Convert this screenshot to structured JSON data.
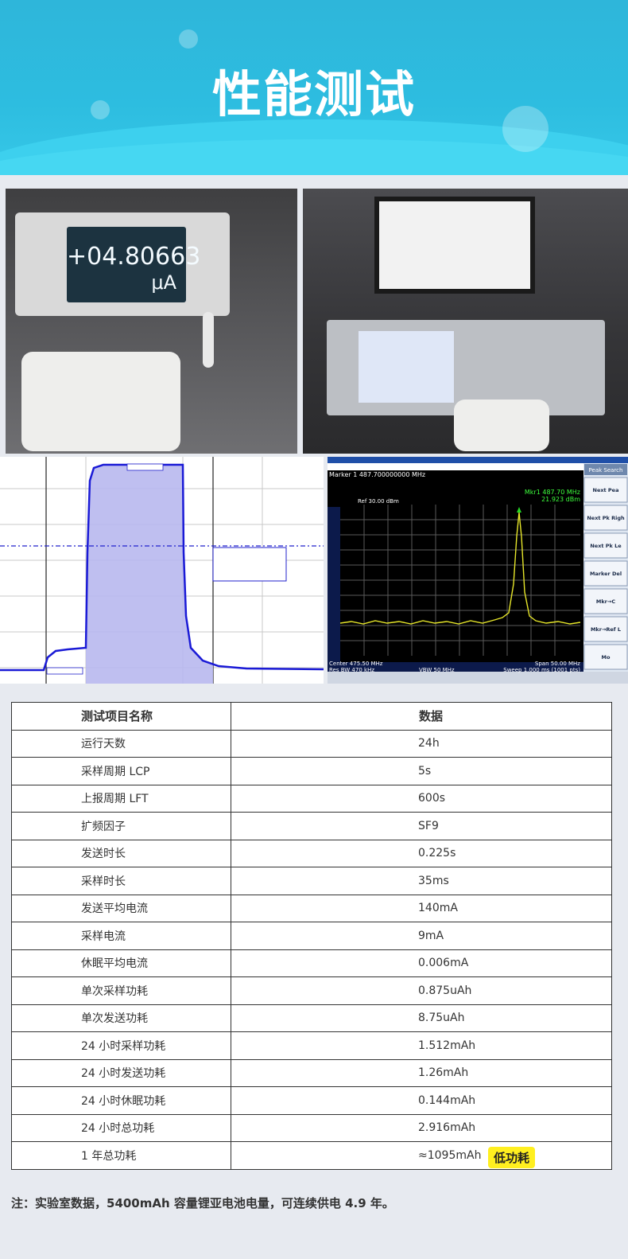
{
  "header": {
    "title": "性能测试"
  },
  "photos": {
    "meter_reading": "+04.80663",
    "meter_unit": "μA"
  },
  "spectrum": {
    "marker": "Marker 1 487.700000000 MHz",
    "ref": "Ref 30.00 dBm",
    "mkr_freq": "Mkr1 487.70 MHz",
    "mkr_level": "21.923 dBm",
    "center": "Center 475.50 MHz",
    "span": "Span 50.00 MHz",
    "rbw": "Res BW 470 kHz",
    "vbw": "VBW 50 MHz",
    "sweep": "Sweep  1.000 ms (1001 pts)",
    "menu_title": "Peak Search",
    "menu": [
      "Next Pea",
      "Next Pk Righ",
      "Next Pk Le",
      "Marker Del",
      "Mkr→C",
      "Mkr→Ref L",
      "Mo"
    ]
  },
  "table": {
    "headers": [
      "测试项目名称",
      "数据"
    ],
    "rows": [
      [
        "运行天数",
        "24h"
      ],
      [
        "采样周期 LCP",
        "5s"
      ],
      [
        "上报周期 LFT",
        "600s"
      ],
      [
        "扩频因子",
        "SF9"
      ],
      [
        "发送时长",
        "0.225s"
      ],
      [
        "采样时长",
        "35ms"
      ],
      [
        "发送平均电流",
        "140mA"
      ],
      [
        "采样电流",
        "9mA"
      ],
      [
        "休眠平均电流",
        "0.006mA"
      ],
      [
        "单次采样功耗",
        "0.875uAh"
      ],
      [
        "单次发送功耗",
        "8.75uAh"
      ],
      [
        "24 小时采样功耗",
        "1.512mAh"
      ],
      [
        "24 小时发送功耗",
        "1.26mAh"
      ],
      [
        "24 小时休眠功耗",
        "0.144mAh"
      ],
      [
        "24 小时总功耗",
        "2.916mAh"
      ],
      [
        "1 年总功耗",
        "≈1095mAh"
      ]
    ]
  },
  "badge": "低功耗",
  "note": "注：实验室数据，5400mAh 容量锂亚电池电量，可连续供电 4.9 年。",
  "colors": {
    "banner": "#2eb6da",
    "badge": "#ffef1f",
    "trace": "#1a1ad6",
    "spectrum": "#e6e62a"
  }
}
